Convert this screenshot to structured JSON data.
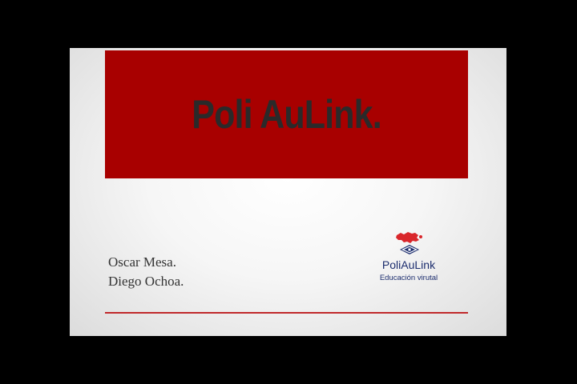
{
  "slide": {
    "title": "Poli AuLink.",
    "authors": [
      "Oscar Mesa.",
      "Diego Ochoa."
    ],
    "logo": {
      "name": "PoliAuLink",
      "tagline": "Educación virutal",
      "icon": "poliaulink-logo-icon"
    }
  },
  "colors": {
    "background": "#000000",
    "title_box": "#a80000",
    "title_text": "#2a2a2a",
    "rule": "#c0292b",
    "logo_text": "#1c2d6e"
  }
}
